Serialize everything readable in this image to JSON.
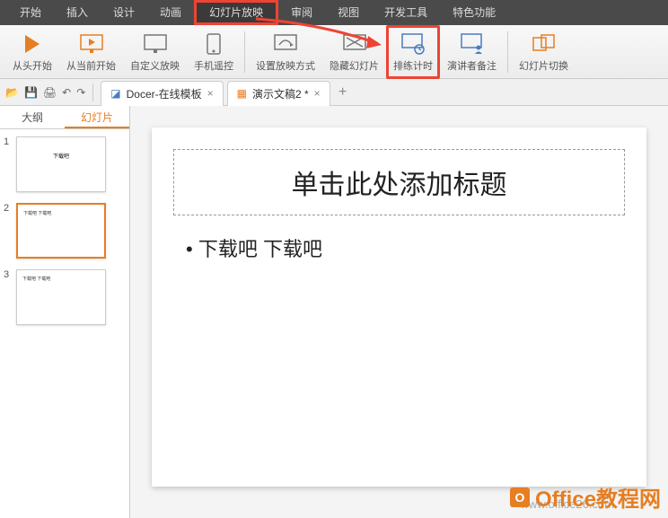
{
  "menubar": {
    "items": [
      {
        "label": "开始"
      },
      {
        "label": "插入"
      },
      {
        "label": "设计"
      },
      {
        "label": "动画"
      },
      {
        "label": "幻灯片放映",
        "highlighted": true
      },
      {
        "label": "审阅"
      },
      {
        "label": "视图"
      },
      {
        "label": "开发工具"
      },
      {
        "label": "特色功能"
      }
    ]
  },
  "ribbon": {
    "groups": [
      {
        "label": "从头开始",
        "icon_color": "#e67e22"
      },
      {
        "label": "从当前开始",
        "icon_color": "#e67e22"
      },
      {
        "label": "自定义放映",
        "icon_color": "#555"
      },
      {
        "label": "手机遥控",
        "icon_color": "#555"
      },
      {
        "label": "设置放映方式",
        "icon_color": "#555"
      },
      {
        "label": "隐藏幻灯片",
        "icon_color": "#555"
      },
      {
        "label": "排练计时",
        "icon_color": "#4a7cbf",
        "highlighted": true
      },
      {
        "label": "演讲者备注",
        "icon_color": "#4a7cbf"
      },
      {
        "label": "幻灯片切换",
        "icon_color": "#e67e22"
      }
    ]
  },
  "tabs": {
    "tab1": {
      "label": "Docer-在线模板"
    },
    "tab2": {
      "label": "演示文稿2 *"
    }
  },
  "sidebar": {
    "tabs": {
      "outline": "大纲",
      "slides": "幻灯片"
    },
    "thumbnails": [
      {
        "num": "1",
        "content": "下载吧"
      },
      {
        "num": "2",
        "content": "下载吧  下载吧",
        "active": true
      },
      {
        "num": "3",
        "content": "下载吧  下载吧"
      }
    ]
  },
  "slide": {
    "title_placeholder": "单击此处添加标题",
    "body_text": "下载吧  下载吧"
  },
  "watermark": {
    "brand": "Office教程网",
    "url": "www.office26.com"
  }
}
